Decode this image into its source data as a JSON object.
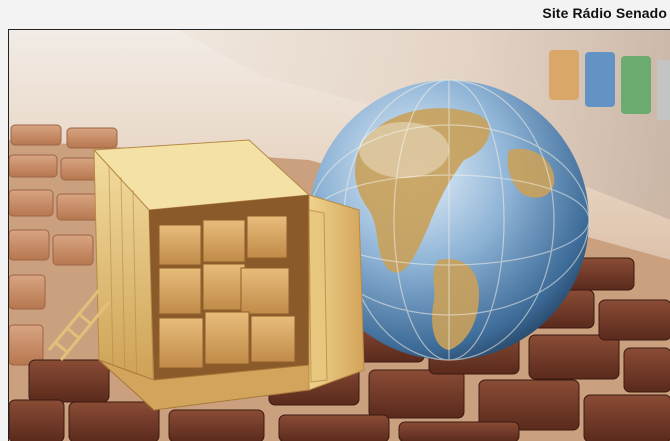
{
  "image": {
    "credit": "Site Rádio Senado"
  }
}
